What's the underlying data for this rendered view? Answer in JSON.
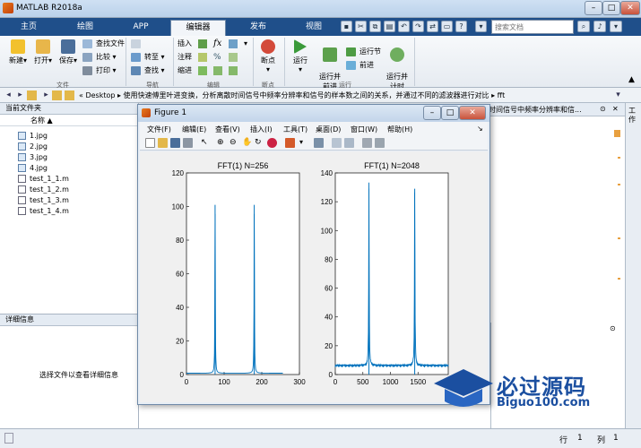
{
  "app": {
    "title": "MATLAB R2018a"
  },
  "tabs": [
    "主页",
    "绘图",
    "APP",
    "编辑器",
    "发布",
    "视图"
  ],
  "active_tab": "编辑器",
  "search": {
    "placeholder": "搜索文档"
  },
  "ribbon": {
    "new": "新建",
    "open": "打开",
    "save": "保存",
    "find_file": "查找文件",
    "compare": "比较",
    "print": "打印",
    "goto": "转至",
    "find": "查找",
    "insert": "插入",
    "comment": "注释",
    "indent": "缩进",
    "fx": "fx",
    "breakpoints": "断点",
    "run": "运行",
    "run_advance": "运行并\n前进",
    "run_section": "运行节",
    "advance": "前进",
    "run_time": "运行并\n计时",
    "groups": {
      "file": "文件",
      "navigate": "导航",
      "edit": "编辑",
      "breakpoints": "断点",
      "run": "运行"
    }
  },
  "path": {
    "prefix": "« Desktop",
    "folder": "使用快速傅里叶进变换，分析离散时间信号中频率分辨率和信号的样本数之间的关系，并通过不同的滤波器进行对比",
    "leaf": "fft",
    "right_tab": "散时间信号中频率分辨率和信..."
  },
  "file_panel": {
    "header": "当前文件夹",
    "column": "名称 ▲",
    "files": [
      "1.jpg",
      "2.jpg",
      "3.jpg",
      "4.jpg",
      "test_1_1.m",
      "test_1_2.m",
      "test_1_3.m",
      "test_1_4.m"
    ]
  },
  "detail_panel": {
    "header": "详细信息",
    "hint": "选择文件以查看详细信息"
  },
  "workspace_tab": "工作",
  "status": {
    "row_label": "行",
    "row": "1",
    "col_label": "列",
    "col": "1"
  },
  "figure": {
    "title": "Figure 1",
    "menu": [
      "文件(F)",
      "编辑(E)",
      "查看(V)",
      "插入(I)",
      "工具(T)",
      "桌面(D)",
      "窗口(W)",
      "帮助(H)"
    ]
  },
  "chart_data": [
    {
      "type": "line",
      "title": "FFT(1) N=256",
      "xlim": [
        0,
        300
      ],
      "ylim": [
        0,
        120
      ],
      "xticks": [
        0,
        100,
        200,
        300
      ],
      "yticks": [
        0,
        20,
        40,
        60,
        80,
        100,
        120
      ],
      "peaks": [
        {
          "x": 76,
          "y": 101
        },
        {
          "x": 180,
          "y": 101
        }
      ],
      "x_end": 256,
      "baseline": 2,
      "color": "#0072bd"
    },
    {
      "type": "line",
      "title": "FFT(1) N=2048",
      "xlim": [
        0,
        2048
      ],
      "ylim": [
        0,
        140
      ],
      "xticks": [
        0,
        500,
        1000,
        1500
      ],
      "yticks": [
        0,
        20,
        40,
        60,
        80,
        100,
        120,
        140
      ],
      "peaks": [
        {
          "x": 610,
          "y": 129
        },
        {
          "x": 1440,
          "y": 129
        }
      ],
      "x_end": 2048,
      "baseline": 5,
      "color": "#0072bd"
    }
  ],
  "watermark": {
    "text": "必过源码",
    "url": "Biguo100.com"
  },
  "colors": {
    "tab_bar": "#1f4f8a",
    "plot_line": "#0072bd",
    "watermark": "#1b4fa0"
  }
}
